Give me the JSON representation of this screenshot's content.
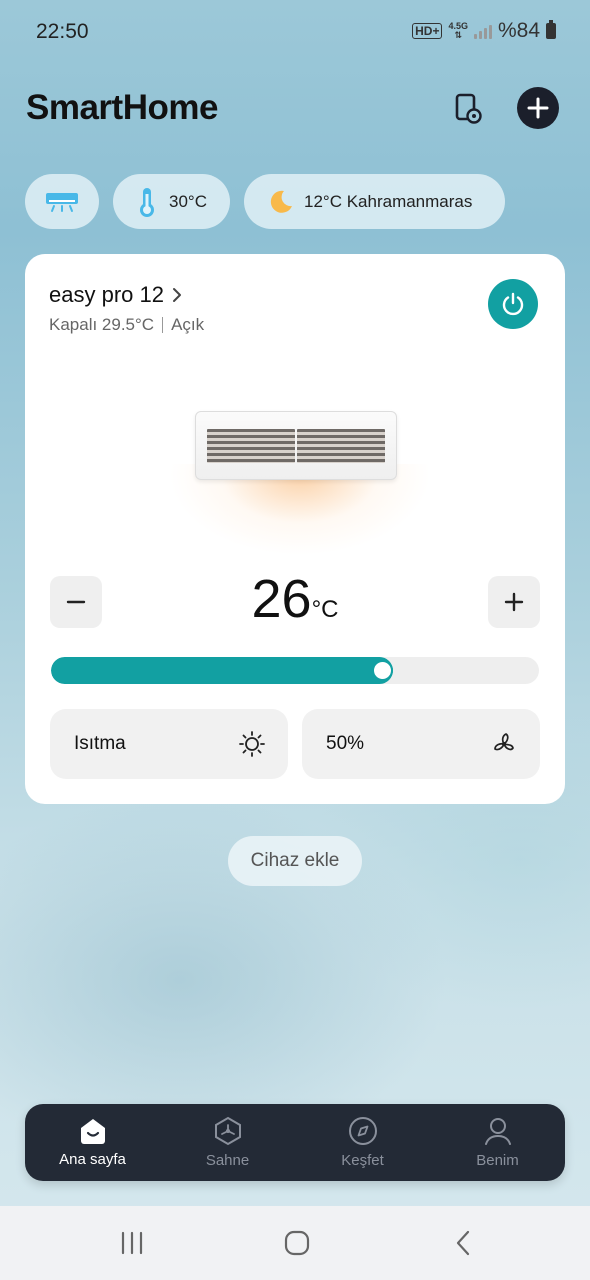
{
  "status_bar": {
    "time": "22:50",
    "hd": "HD+",
    "network": "4.5G",
    "battery": "%84"
  },
  "header": {
    "title": "SmartHome",
    "device_icon": "device-settings-icon",
    "add_icon": "plus-icon"
  },
  "chips": {
    "ac_icon": "air-conditioner-icon",
    "temperature": {
      "icon": "thermometer-icon",
      "value": "30°C"
    },
    "weather": {
      "icon": "moon-icon",
      "value": "12°C Kahramanmaras"
    }
  },
  "device_card": {
    "name": "easy pro 12",
    "status_left": "Kapalı 29.5°C",
    "status_right": "Açık",
    "power_icon": "power-icon",
    "target_temperature": "26",
    "temperature_unit": "°C",
    "slider_level": 0.7,
    "mode": {
      "label": "Isıtma",
      "icon": "sun-icon"
    },
    "fan": {
      "label": "50%",
      "icon": "fan-icon"
    },
    "colors": {
      "accent": "#12a0a2"
    }
  },
  "add_device_label": "Cihaz ekle",
  "tab_bar": {
    "tabs": [
      {
        "label": "Ana sayfa",
        "icon": "home-icon",
        "active": true
      },
      {
        "label": "Sahne",
        "icon": "scene-icon",
        "active": false
      },
      {
        "label": "Keşfet",
        "icon": "compass-icon",
        "active": false
      },
      {
        "label": "Benim",
        "icon": "profile-icon",
        "active": false
      }
    ]
  },
  "system_nav": {
    "recents": "recents-icon",
    "home": "home-circle-icon",
    "back": "back-icon"
  }
}
